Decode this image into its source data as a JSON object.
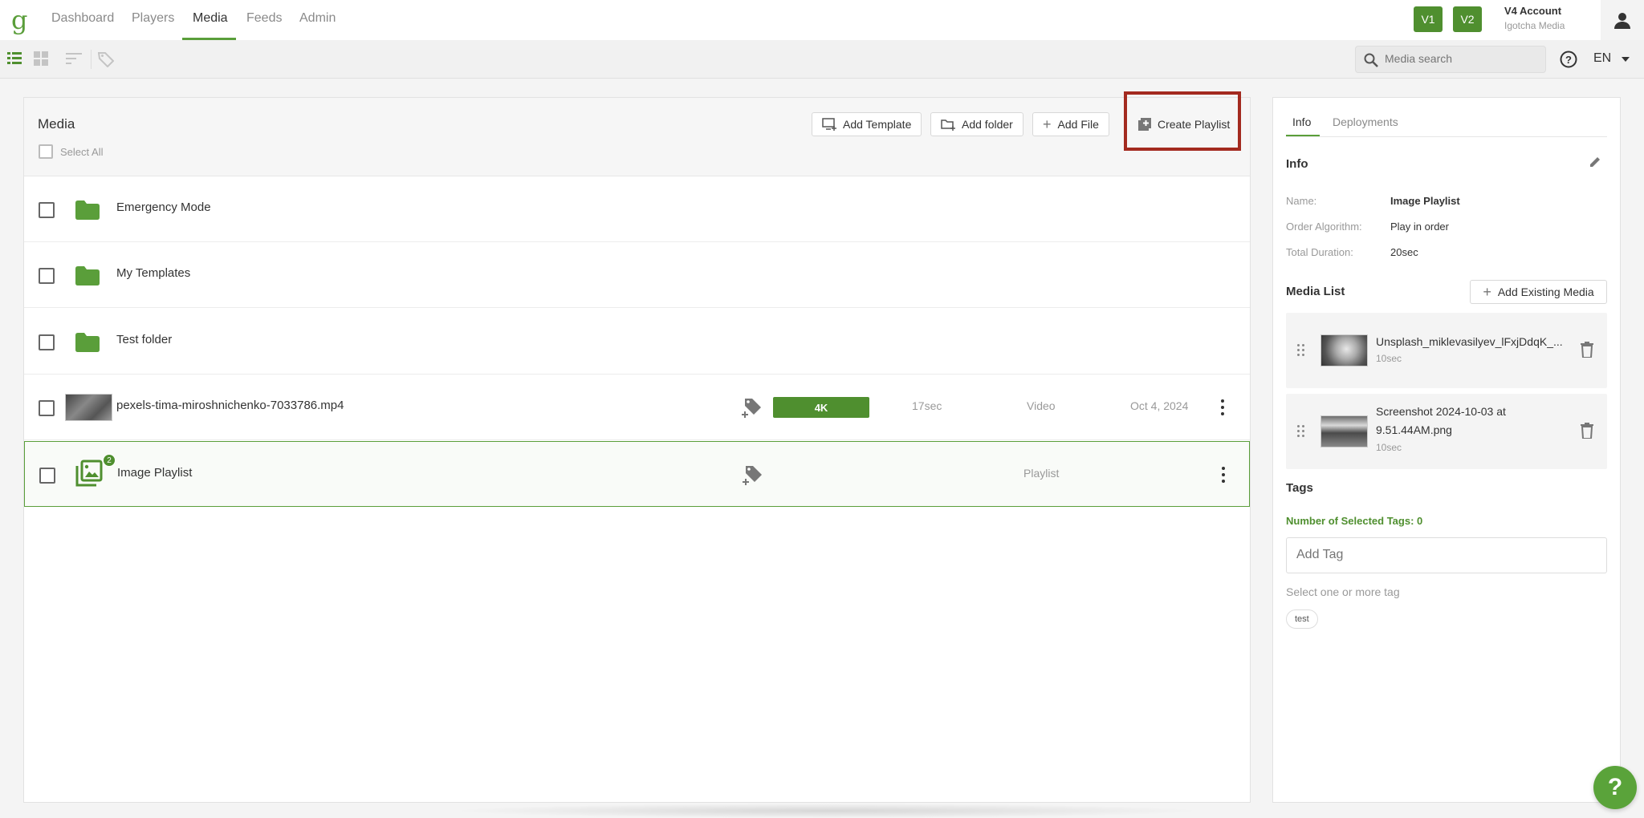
{
  "nav": {
    "logo": "g",
    "items": [
      {
        "label": "Dashboard"
      },
      {
        "label": "Players"
      },
      {
        "label": "Media"
      },
      {
        "label": "Feeds"
      },
      {
        "label": "Admin"
      }
    ],
    "active": "Media",
    "v1": "V1",
    "v2": "V2",
    "account_name": "V4 Account",
    "account_org": "Igotcha Media"
  },
  "toolbar": {
    "search_placeholder": "Media search",
    "language": "EN"
  },
  "media": {
    "title": "Media",
    "select_all": "Select All",
    "buttons": {
      "add_template": "Add Template",
      "add_folder": "Add folder",
      "add_file": "Add File",
      "create_playlist": "Create Playlist"
    },
    "rows": [
      {
        "name": "Emergency Mode",
        "kind": "folder"
      },
      {
        "name": "My Templates",
        "kind": "folder"
      },
      {
        "name": "Test folder",
        "kind": "folder"
      },
      {
        "name": "pexels-tima-miroshnichenko-7033786.mp4",
        "kind": "video",
        "resolution": "4K",
        "duration": "17sec",
        "type": "Video",
        "date": "Oct 4, 2024"
      },
      {
        "name": "Image Playlist",
        "kind": "playlist",
        "count": "2",
        "type": "Playlist"
      }
    ]
  },
  "details": {
    "tabs": {
      "info": "Info",
      "deployments": "Deployments"
    },
    "info_title": "Info",
    "fields": {
      "name_label": "Name:",
      "name_value": "Image Playlist",
      "order_label": "Order Algorithm:",
      "order_value": "Play in order",
      "duration_label": "Total Duration:",
      "duration_value": "20sec"
    },
    "media_list_title": "Media List",
    "add_existing": "Add Existing Media",
    "media_list": [
      {
        "name": "Unsplash_miklevasilyev_lFxjDdqK_...",
        "duration": "10sec"
      },
      {
        "name": "Screenshot 2024-10-03 at 9.51.44AM.png",
        "duration": "10sec"
      }
    ],
    "tags_title": "Tags",
    "tags_count": "Number of Selected Tags: 0",
    "add_tag_placeholder": "Add Tag",
    "tag_hint": "Select one or more tag",
    "tag_chip": "test"
  },
  "colors": {
    "brand_green": "#4f8f2f",
    "highlight_red": "#a32a1f"
  },
  "help_fab": "?"
}
